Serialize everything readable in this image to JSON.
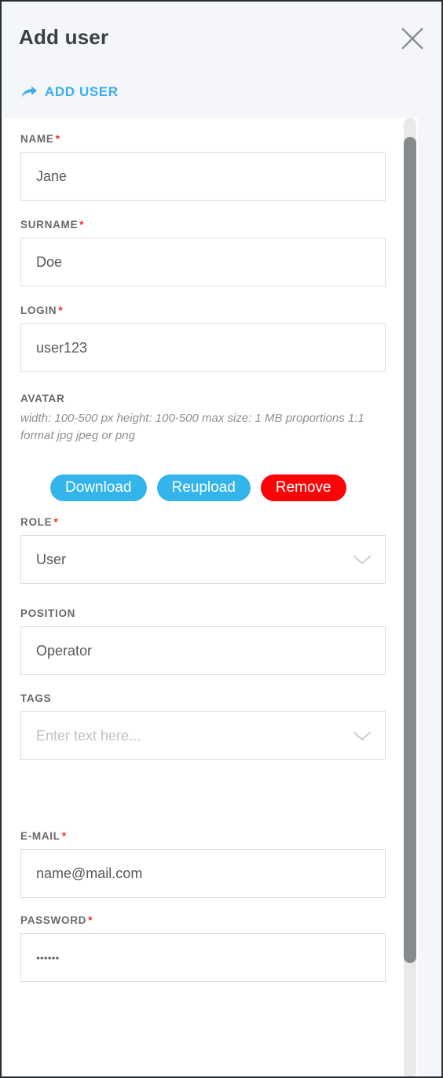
{
  "dialog": {
    "title": "Add user",
    "close_icon": "close-x-icon"
  },
  "action_link": {
    "label": "ADD USER",
    "icon": "forward-arrow-icon",
    "color": "#3aaef0"
  },
  "form": {
    "name": {
      "label": "NAME",
      "required": true,
      "value": "Jane"
    },
    "surname": {
      "label": "SURNAME",
      "required": true,
      "value": "Doe"
    },
    "login": {
      "label": "LOGIN",
      "required": true,
      "value": "user123"
    },
    "avatar": {
      "label": "AVATAR",
      "required": false,
      "hint": "width: 100-500 px height: 100-500 max size: 1 MB proportions 1:1 format jpg jpeg or png",
      "buttons": [
        {
          "label": "Download",
          "color": "#33b4ea"
        },
        {
          "label": "Reupload",
          "color": "#33b4ea"
        },
        {
          "label": "Remove",
          "color": "#fb0408"
        }
      ]
    },
    "role": {
      "label": "ROLE",
      "required": true,
      "value": "User",
      "icon": "chevron-down-icon"
    },
    "position": {
      "label": "POSITION",
      "required": false,
      "value": "Operator"
    },
    "tags": {
      "label": "TAGS",
      "required": false,
      "value": "",
      "placeholder": "Enter text here...",
      "icon": "chevron-down-icon"
    },
    "email": {
      "label": "E-MAIL",
      "required": true,
      "value": "name@mail.com"
    },
    "password": {
      "label": "PASSWORD",
      "required": true,
      "value": "••••••"
    }
  },
  "scrollbar": {
    "orientation": "vertical"
  }
}
